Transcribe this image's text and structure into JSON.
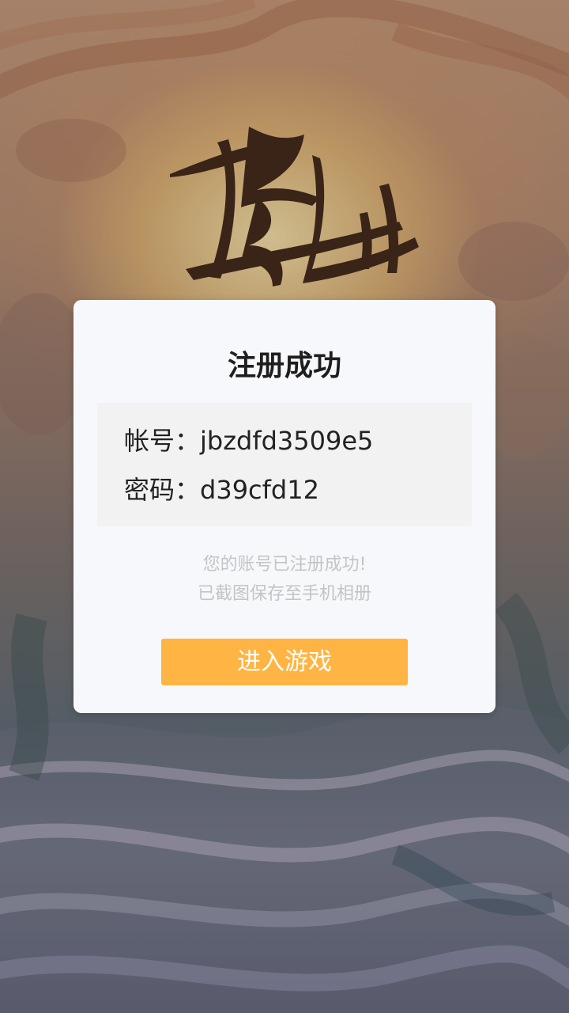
{
  "background": {
    "logo_text": "修仙"
  },
  "dialog": {
    "title": "注册成功",
    "account_label": "帐号：",
    "account_value": "jbzdfd3509e5",
    "password_label": "密码：",
    "password_value": "d39cfd12",
    "note_line1": "您的账号已注册成功!",
    "note_line2": "已截图保存至手机相册",
    "enter_button": "进入游戏"
  },
  "colors": {
    "dialog_bg": "#f7f8fb",
    "info_box_bg": "#f2f2f2",
    "button_bg": "#ffb443",
    "note_text": "#c4c4c4"
  }
}
